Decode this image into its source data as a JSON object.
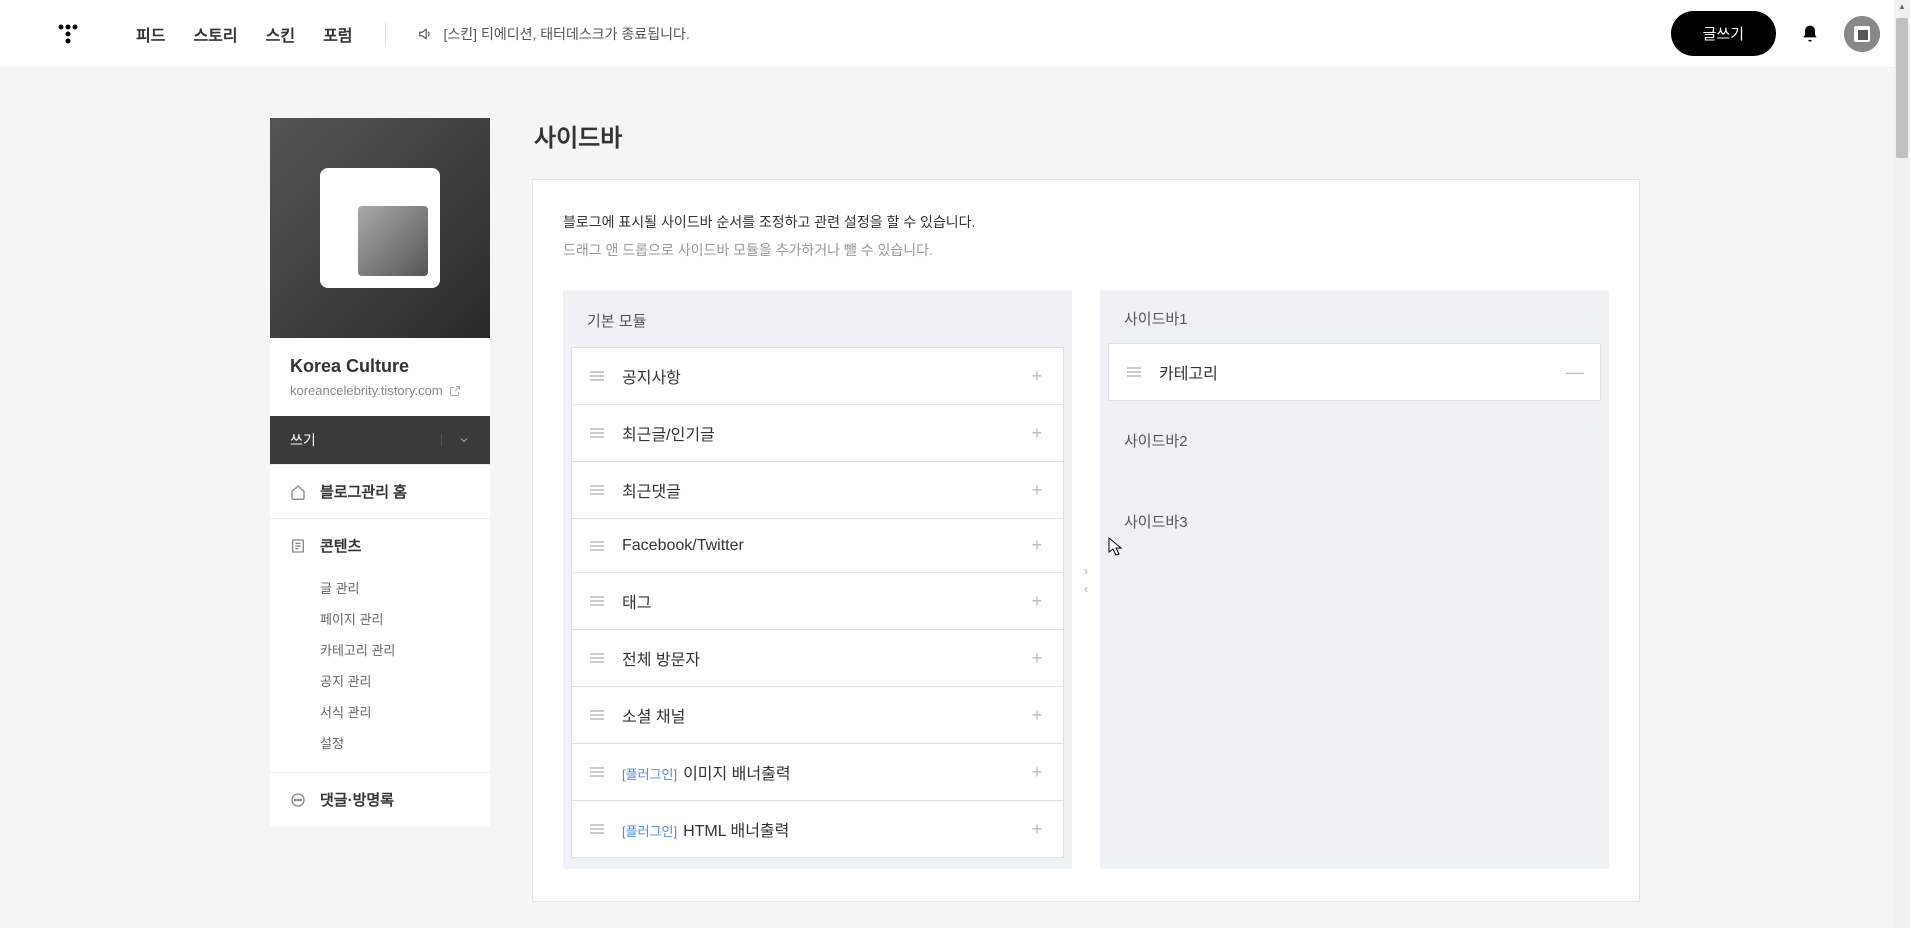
{
  "header": {
    "nav": [
      "피드",
      "스토리",
      "스킨",
      "포럼"
    ],
    "announce_tag": "[스킨]",
    "announce_text": "티에디션, 태터데스크가 종료됩니다.",
    "write_button": "글쓰기"
  },
  "profile": {
    "name": "Korea Culture",
    "url": "koreancelebrity.tistory.com"
  },
  "left_menu": {
    "write": "쓰기",
    "home": "블로그관리 홈",
    "contents": {
      "label": "콘텐츠",
      "items": [
        "글 관리",
        "페이지 관리",
        "카테고리 관리",
        "공지 관리",
        "서식 관리",
        "설정"
      ]
    },
    "comments_label": "댓글·방명록"
  },
  "page": {
    "title": "사이드바",
    "desc1": "블로그에 표시될 사이드바 순서를 조정하고 관련 설정을 할 수 있습니다.",
    "desc2": "드래그 앤 드롭으로 사이드바 모듈을 추가하거나 뺄 수 있습니다."
  },
  "modules": {
    "basic_header": "기본 모듈",
    "basic": [
      {
        "label": "공지사항",
        "plugin": false
      },
      {
        "label": "최근글/인기글",
        "plugin": false
      },
      {
        "label": "최근댓글",
        "plugin": false
      },
      {
        "label": "Facebook/Twitter",
        "plugin": false
      },
      {
        "label": "태그",
        "plugin": false
      },
      {
        "label": "전체 방문자",
        "plugin": false
      },
      {
        "label": "소셜 채널",
        "plugin": false
      },
      {
        "label": "이미지 배너출력",
        "plugin": true
      },
      {
        "label": "HTML 배너출력",
        "plugin": true
      }
    ],
    "plugin_tag": "[플러그인]",
    "sidebar1_header": "사이드바1",
    "sidebar1": [
      {
        "label": "카테고리"
      }
    ],
    "sidebar2_header": "사이드바2",
    "sidebar3_header": "사이드바3"
  }
}
